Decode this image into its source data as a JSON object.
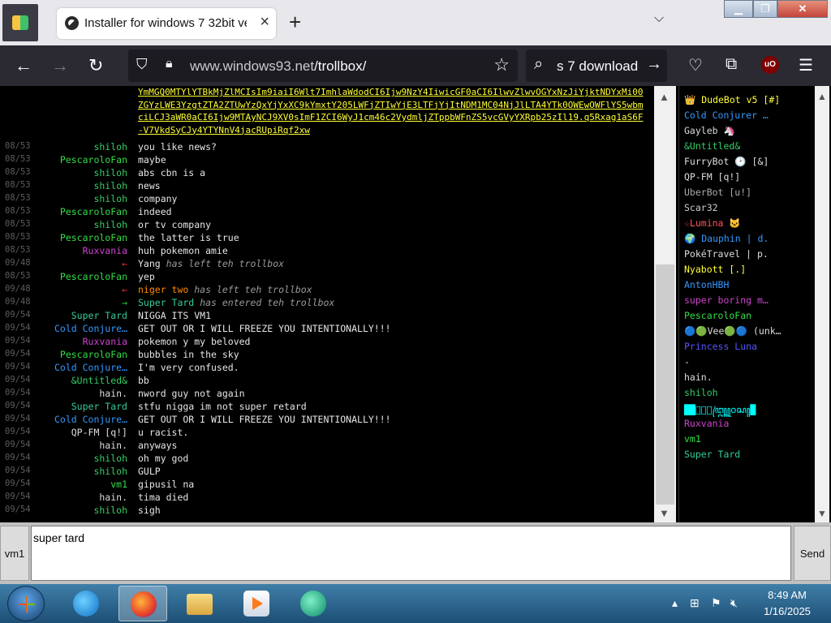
{
  "tab": {
    "title": "Installer for windows 7 32bit ver"
  },
  "url": {
    "host": "www.windows93.net",
    "path": "/trollbox/"
  },
  "search": {
    "value": "s 7 download"
  },
  "chat": {
    "link_text": "YmMGQ0MTYlYTBkMjZlMCIsIm9iaiI6Wlt7ImhlaWdodCI6Ijw9NzY4IiwicGF0aCI6IlwvZlwvOGYxNzJiYjktNDYxMi00ZGYzLWE3YzgtZTA2ZTUwYzQxYjYxXC9kYmxtY205LWFjZTIwYjE3LTFjYjItNDM1MC04NjJlLTA4YTk0OWEwOWFlYS5wbmciLCJ3aWR0aCI6Ijw9MTAyNCJ9XV0sImF1ZCI6WyJ1cm46c2VydmljZTppbWFnZS5vcGVyYXRpb25zIl19.q5Rxag1aS6F-V7VkdSyCJy4YTYNnV4jacRUpiRqf2xw",
    "lines": [
      {
        "time": "08/53",
        "nick": "shiloh",
        "color": "#33cc66",
        "msg": "you like news?"
      },
      {
        "time": "08/53",
        "nick": "PescaroloFan",
        "color": "#33dd44",
        "msg": "maybe"
      },
      {
        "time": "08/53",
        "nick": "shiloh",
        "color": "#33cc66",
        "msg": "abs cbn is a"
      },
      {
        "time": "08/53",
        "nick": "shiloh",
        "color": "#33cc66",
        "msg": "news"
      },
      {
        "time": "08/53",
        "nick": "shiloh",
        "color": "#33cc66",
        "msg": "company"
      },
      {
        "time": "08/53",
        "nick": "PescaroloFan",
        "color": "#33dd44",
        "msg": "indeed"
      },
      {
        "time": "08/53",
        "nick": "shiloh",
        "color": "#33cc66",
        "msg": "or tv company"
      },
      {
        "time": "08/53",
        "nick": "PescaroloFan",
        "color": "#33dd44",
        "msg": "the latter is true"
      },
      {
        "time": "08/53",
        "nick": "Ruxvania",
        "color": "#cc44cc",
        "msg": "huh pokemon amie"
      },
      {
        "time": "09/48",
        "nick": "←",
        "color": "#ff3333",
        "msg": "Yang",
        "action": "has left teh trollbox"
      },
      {
        "time": "08/53",
        "nick": "PescaroloFan",
        "color": "#33dd44",
        "msg": "yep"
      },
      {
        "time": "09/48",
        "nick": "←",
        "color": "#ff3333",
        "msg": "niger two",
        "msgcolor": "#ff8800",
        "action": "has left teh trollbox"
      },
      {
        "time": "09/48",
        "nick": "→",
        "color": "#33dd44",
        "msg": "Super Tard",
        "msgcolor": "#33cc99",
        "action": "has entered teh trollbox"
      },
      {
        "time": "09/54",
        "nick": "Super Tard",
        "color": "#33cc99",
        "msg": "NIGGA ITS VM1"
      },
      {
        "time": "09/54",
        "nick": "Cold Conjure…",
        "color": "#3399ff",
        "msg": "GET OUT OR I WILL FREEZE YOU INTENTIONALLY!!!"
      },
      {
        "time": "09/54",
        "nick": "Ruxvania",
        "color": "#cc44cc",
        "msg": "pokemon y my beloved"
      },
      {
        "time": "09/54",
        "nick": "PescaroloFan",
        "color": "#33dd44",
        "msg": "bubbles in the sky"
      },
      {
        "time": "09/54",
        "nick": "Cold Conjure…",
        "color": "#3399ff",
        "msg": "I'm very confused."
      },
      {
        "time": "09/54",
        "nick": "&Untitled&",
        "color": "#33cc66",
        "msg": "bb"
      },
      {
        "time": "09/54",
        "nick": "hain.",
        "color": "#dddddd",
        "msg": "nword guy not again"
      },
      {
        "time": "09/54",
        "nick": "Super Tard",
        "color": "#33cc99",
        "msg": "stfu nigga im not super retard"
      },
      {
        "time": "09/54",
        "nick": "Cold Conjure…",
        "color": "#3399ff",
        "msg": "GET OUT OR I WILL FREEZE YOU INTENTIONALLY!!!"
      },
      {
        "time": "09/54",
        "nick": "QP-FM [q!]",
        "color": "#dddddd",
        "msg": "u racist."
      },
      {
        "time": "09/54",
        "nick": "hain.",
        "color": "#dddddd",
        "msg": "anyways"
      },
      {
        "time": "09/54",
        "nick": "shiloh",
        "color": "#33cc66",
        "msg": "oh my god"
      },
      {
        "time": "09/54",
        "nick": "shiloh",
        "color": "#33cc66",
        "msg": "GULP"
      },
      {
        "time": "09/54",
        "nick": "vm1",
        "color": "#33dd44",
        "msg": "gipusil na"
      },
      {
        "time": "09/54",
        "nick": "hain.",
        "color": "#dddddd",
        "msg": "tima died"
      },
      {
        "time": "09/54",
        "nick": "shiloh",
        "color": "#33cc66",
        "msg": "sigh"
      }
    ]
  },
  "users": [
    {
      "name": "👑 DudeBot v5 [#]",
      "color": "#ffff33"
    },
    {
      "name": "Cold Conjurer …",
      "color": "#3399ff"
    },
    {
      "name": "Gayleb 🦄",
      "color": "#dddddd"
    },
    {
      "name": "&Untitled&",
      "color": "#33cc66"
    },
    {
      "name": "FurryBot 🕑 [&]",
      "color": "#dddddd"
    },
    {
      "name": "QP-FM [q!]",
      "color": "#dddddd"
    },
    {
      "name": "UberBot [u!]",
      "color": "#aaaaaa"
    },
    {
      "name": "Scar32",
      "color": "#cccccc"
    },
    {
      "name": "☆Lumina 🐱",
      "color": "#ff5555"
    },
    {
      "name": "🌍 Dauphin | d.",
      "color": "#3399ff"
    },
    {
      "name": "PokéTravel | p.",
      "color": "#dddddd"
    },
    {
      "name": "Nyabott [.]",
      "color": "#ffff33"
    },
    {
      "name": "AntonHBH",
      "color": "#3399ff"
    },
    {
      "name": "super boring m…",
      "color": "#cc44cc"
    },
    {
      "name": "PescaroloFan",
      "color": "#33dd44"
    },
    {
      "name": "🔵🟢Vee🟢🔵 (unk…",
      "color": "#dddddd"
    },
    {
      "name": "Princess Luna",
      "color": "#5555ff"
    },
    {
      "name": "-",
      "color": "#dddddd"
    },
    {
      "name": "hain.",
      "color": "#dddddd"
    },
    {
      "name": "shiloh",
      "color": "#33cc66"
    },
    {
      "name": "██ꦿꦶꦸ꧅꧆ꦱ꧀█",
      "color": "#00ffff"
    },
    {
      "name": "Ruxvania",
      "color": "#cc44cc"
    },
    {
      "name": "vm1",
      "color": "#33dd44"
    },
    {
      "name": "Super Tard",
      "color": "#33cc99"
    }
  ],
  "input": {
    "nick": "vm1",
    "value": "super tard",
    "send_label": "Send"
  },
  "taskbar": {
    "time": "8:49 AM",
    "date": "1/16/2025"
  }
}
